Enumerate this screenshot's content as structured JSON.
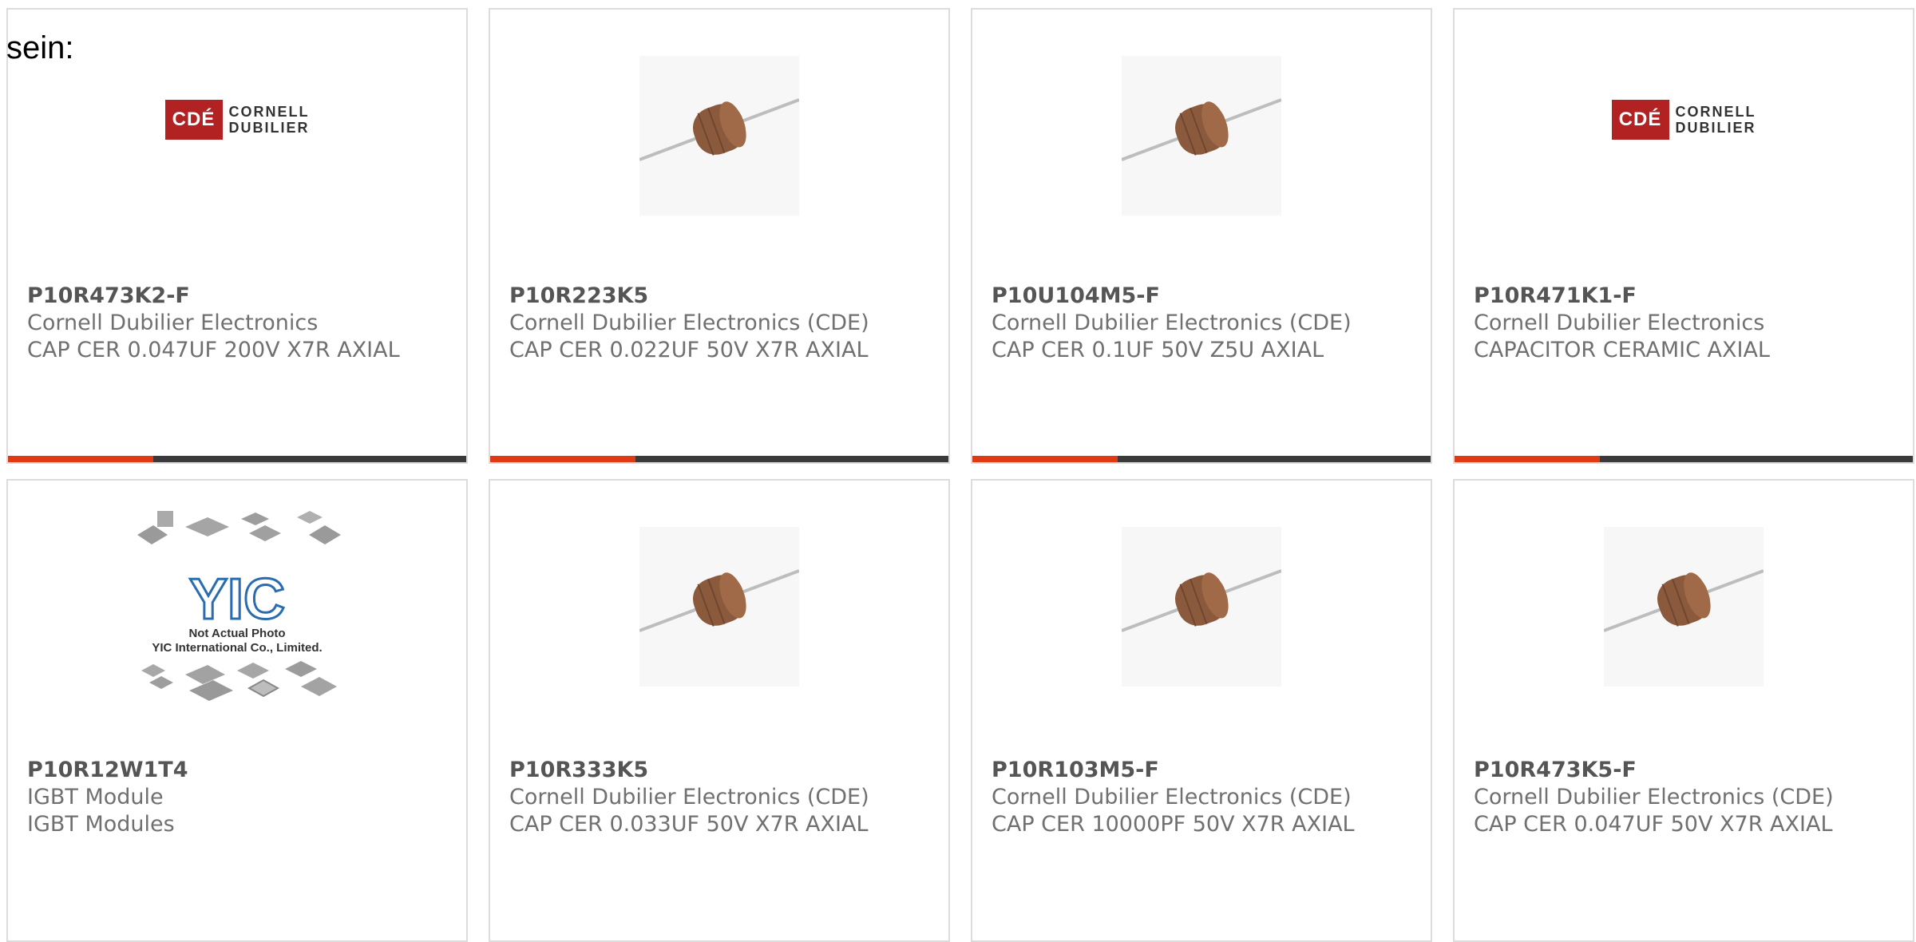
{
  "heading": "sein:",
  "logo": {
    "badge_text": "CDÉ",
    "line1": "CORNELL",
    "line2": "DUBILIER"
  },
  "not_actual_photo": {
    "brand": "YIC",
    "line1": "Not Actual Photo",
    "line2": "YIC International Co., Limited."
  },
  "products": [
    {
      "part_no": "P10R473K2-F",
      "manufacturer": "Cornell Dubilier Electronics",
      "description": "CAP CER 0.047UF 200V X7R AXIAL",
      "image": "cde-logo"
    },
    {
      "part_no": "P10R223K5",
      "manufacturer": "Cornell Dubilier Electronics (CDE)",
      "description": "CAP CER 0.022UF 50V X7R AXIAL",
      "image": "axial-capacitor"
    },
    {
      "part_no": "P10U104M5-F",
      "manufacturer": "Cornell Dubilier Electronics (CDE)",
      "description": "CAP CER 0.1UF 50V Z5U AXIAL",
      "image": "axial-capacitor"
    },
    {
      "part_no": "P10R471K1-F",
      "manufacturer": "Cornell Dubilier Electronics",
      "description": "CAPACITOR CERAMIC AXIAL",
      "image": "cde-logo"
    },
    {
      "part_no": "P10R12W1T4",
      "manufacturer": "IGBT Module",
      "description": "IGBT Modules",
      "image": "not-actual-photo"
    },
    {
      "part_no": "P10R333K5",
      "manufacturer": "Cornell Dubilier Electronics (CDE)",
      "description": "CAP CER 0.033UF 50V X7R AXIAL",
      "image": "axial-capacitor"
    },
    {
      "part_no": "P10R103M5-F",
      "manufacturer": "Cornell Dubilier Electronics (CDE)",
      "description": "CAP CER 10000PF 50V X7R AXIAL",
      "image": "axial-capacitor"
    },
    {
      "part_no": "P10R473K5-F",
      "manufacturer": "Cornell Dubilier Electronics (CDE)",
      "description": "CAP CER 0.047UF 50V X7R AXIAL",
      "image": "axial-capacitor"
    }
  ],
  "colors": {
    "accent": "#e03a14",
    "bar": "#3a3a3a",
    "border": "#dcdcdc",
    "capacitor_body": "#8b5a3c",
    "logo_red": "#b22222"
  }
}
